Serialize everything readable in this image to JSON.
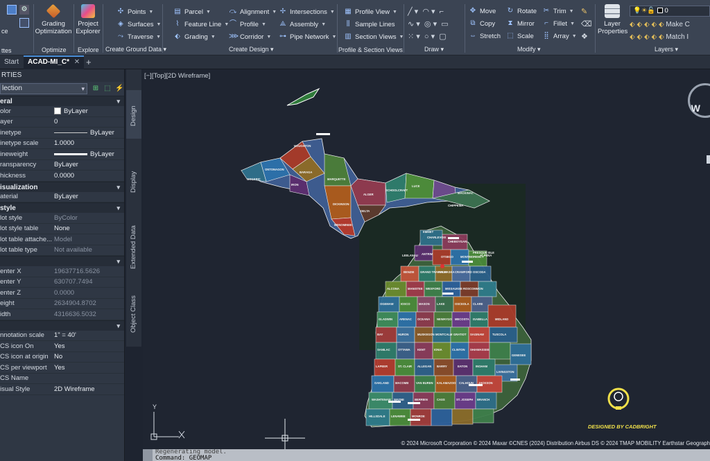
{
  "ribbon": {
    "left_labels": [
      "ttes",
      "ce"
    ],
    "groups": [
      {
        "title": "Optimize",
        "big": "Grading Optimization"
      },
      {
        "title": "Explore",
        "big": "Project Explorer"
      },
      {
        "title": "Create Ground Data",
        "items": [
          "Points",
          "Surfaces",
          "Traverse"
        ]
      },
      {
        "title": "Create Design",
        "items": [
          "Parcel",
          "Feature Line",
          "Grading",
          "Alignment",
          "Profile",
          "Corridor",
          "Intersections",
          "Assembly",
          "Pipe Network"
        ]
      },
      {
        "title": "Profile & Section Views",
        "items": [
          "Profile View",
          "Sample Lines",
          "Section Views"
        ]
      },
      {
        "title": "Draw"
      },
      {
        "title": "Modify",
        "items": [
          "Move",
          "Copy",
          "Stretch",
          "Rotate",
          "Mirror",
          "Scale",
          "Trim",
          "Fillet",
          "Array"
        ]
      },
      {
        "title": "Layers",
        "big": "Layer Properties",
        "items": [
          "Make C",
          "Match I"
        ],
        "layer_value": "0"
      }
    ]
  },
  "tabs": {
    "start": "Start",
    "active": "ACAD-MI_C*",
    "add": "+"
  },
  "properties": {
    "title": "RTIES",
    "selection": "lection",
    "sections": [
      {
        "name": "eral",
        "rows": [
          {
            "k": "olor",
            "v": "ByLayer",
            "type": "color"
          },
          {
            "k": "ayer",
            "v": "0"
          },
          {
            "k": "inetype",
            "v": "ByLayer",
            "type": "line"
          },
          {
            "k": "inetype scale",
            "v": "1.0000"
          },
          {
            "k": "ineweight",
            "v": "ByLayer",
            "type": "thick"
          },
          {
            "k": "ransparency",
            "v": "ByLayer"
          },
          {
            "k": "hickness",
            "v": "0.0000"
          }
        ]
      },
      {
        "name": "isualization",
        "rows": [
          {
            "k": "aterial",
            "v": "ByLayer"
          }
        ]
      },
      {
        "name": "style",
        "rows": [
          {
            "k": "lot style",
            "v": "ByColor",
            "dim": true
          },
          {
            "k": "lot style table",
            "v": "None"
          },
          {
            "k": "lot table attache...",
            "v": "Model",
            "dim": true
          },
          {
            "k": "lot table type",
            "v": "Not available",
            "dim": true
          }
        ]
      },
      {
        "name": "",
        "rows": [
          {
            "k": "enter X",
            "v": "19637716.5626",
            "dim": true
          },
          {
            "k": "enter Y",
            "v": "630707.7494",
            "dim": true
          },
          {
            "k": "enter Z",
            "v": "0.0000",
            "dim": true
          },
          {
            "k": "eight",
            "v": "2634904.8702",
            "dim": true
          },
          {
            "k": "idth",
            "v": "4316636.5032",
            "dim": true
          }
        ]
      },
      {
        "name": "",
        "rows": [
          {
            "k": "nnotation scale",
            "v": "1\" = 40'"
          },
          {
            "k": "CS icon On",
            "v": "Yes"
          },
          {
            "k": "CS icon at origin",
            "v": "No"
          },
          {
            "k": "CS per viewport",
            "v": "Yes"
          },
          {
            "k": "CS Name",
            "v": ""
          },
          {
            "k": "isual Style",
            "v": "2D Wireframe"
          }
        ]
      }
    ]
  },
  "side_tabs": [
    "Design",
    "Display",
    "Extended Data",
    "Object Class"
  ],
  "viewport": {
    "label": "[−][Top][2D Wireframe]",
    "compass": "W",
    "copyright": "© 2024 Microsoft Corporation © 2024 Maxar ©CNES (2024) Distribution Airbus DS © 2024 TMAP MOBILITY Earthstar Geograph",
    "watermark": "DESIGNED BY CADBRIGHT",
    "ucs_y": "Y",
    "counties": [
      "ONTONAGON",
      "HOUGHTON",
      "BARAGA",
      "GOGEBIC",
      "IRON",
      "MARQUETTE",
      "ALGER",
      "LUCE",
      "SCHOOLCRAFT",
      "DELTA",
      "DICKINSON",
      "MENOMINEE",
      "CHIPPEWA",
      "MACKINAC",
      "CHARLEVOIX",
      "EMMET",
      "CHEBOYGAN",
      "PRESQUE ISLE",
      "ANTRIM",
      "OTSEGO",
      "MONTMORENCY",
      "ALPENA",
      "LEELANAU",
      "BENZIE",
      "GRAND TRAVERSE",
      "KALKASKA",
      "CRAWFORD",
      "OSCODA",
      "ALCONA",
      "MANISTEE",
      "WEXFORD",
      "MISSAUKEE",
      "ROSCOMMON",
      "OGEMAW",
      "IOSCO",
      "MASON",
      "LAKE",
      "OSCEOLA",
      "CLARE",
      "GLADWIN",
      "ARENAC",
      "OCEANA",
      "NEWAYGO",
      "MECOSTA",
      "ISABELLA",
      "MIDLAND",
      "BAY",
      "HURON",
      "MUSKEGON",
      "MONTCALM",
      "GRATIOT",
      "SAGINAW",
      "TUSCOLA",
      "SANILAC",
      "OTTAWA",
      "KENT",
      "IONIA",
      "CLINTON",
      "SHIAWASSEE",
      "GENESEE",
      "LAPEER",
      "ST. CLAIR",
      "ALLEGAN",
      "BARRY",
      "EATON",
      "INGHAM",
      "LIVINGSTON",
      "OAKLAND",
      "MACOMB",
      "VAN BUREN",
      "KALAMAZOO",
      "CALHOUN",
      "JACKSON",
      "WASHTENAW",
      "WAYNE",
      "BERRIEN",
      "CASS",
      "ST. JOSEPH",
      "BRANCH",
      "HILLSDALE",
      "LENAWEE",
      "MONROE"
    ]
  },
  "command": {
    "prev": "Regenerating model.",
    "current": "Command: GEOMAP"
  },
  "colors": {
    "ribbon_bg": "#3b4453",
    "panel_bg": "#2f3744",
    "canvas_bg": "#1f2531",
    "accent": "#4a8fd9"
  }
}
